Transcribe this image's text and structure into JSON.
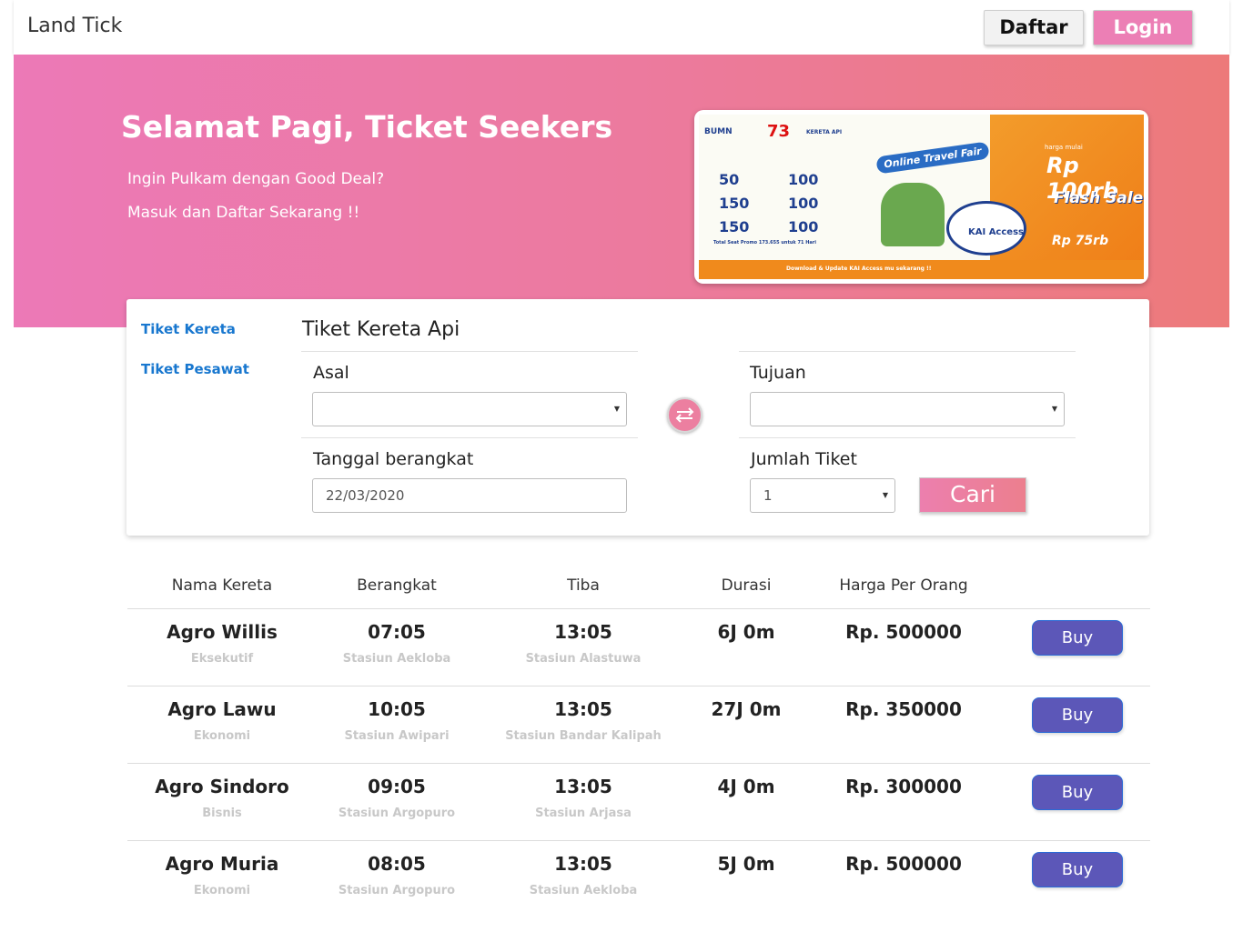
{
  "navbar": {
    "brand": "Land Tick",
    "register_label": "Daftar",
    "login_label": "Login"
  },
  "hero": {
    "title": "Selamat Pagi, Ticket Seekers",
    "line1": "Ingin Pulkam dengan Good Deal?",
    "line2": "Masuk dan Daftar Sekarang !!",
    "promo": {
      "bumn": "BUMN",
      "anniversary": "73",
      "operator": "KERETA API",
      "badge": "Online Travel Fair",
      "prices": [
        "50",
        "100",
        "150",
        "100",
        "150",
        "100"
      ],
      "total": "Total Seat Promo 173.655 untuk 71 Hari",
      "app": "KAI Access",
      "harga_mulai": "harga mulai",
      "price_main": "Rp 100rb",
      "flash": "Flash Sale",
      "price_small": "Rp 75rb",
      "footer": "Download & Update KAI Access mu sekarang !!"
    }
  },
  "search": {
    "tabs": [
      "Tiket Kereta",
      "Tiket Pesawat"
    ],
    "title": "Tiket Kereta Api",
    "origin_label": "Asal",
    "origin_value": "",
    "destination_label": "Tujuan",
    "destination_value": "",
    "date_label": "Tanggal berangkat",
    "date_value": "22/03/2020",
    "qty_label": "Jumlah Tiket",
    "qty_value": "1",
    "submit_label": "Cari"
  },
  "results": {
    "headers": [
      "Nama Kereta",
      "Berangkat",
      "Tiba",
      "Durasi",
      "Harga Per Orang"
    ],
    "buy_label": "Buy",
    "rows": [
      {
        "name": "Agro Willis",
        "class": "Eksekutif",
        "depart": "07:05",
        "depart_station": "Stasiun Aekloba",
        "arrive": "13:05",
        "arrive_station": "Stasiun Alastuwa",
        "duration": "6J 0m",
        "price": "Rp. 500000"
      },
      {
        "name": "Agro Lawu",
        "class": "Ekonomi",
        "depart": "10:05",
        "depart_station": "Stasiun Awipari",
        "arrive": "13:05",
        "arrive_station": "Stasiun Bandar Kalipah",
        "duration": "27J 0m",
        "price": "Rp. 350000"
      },
      {
        "name": "Agro Sindoro",
        "class": "Bisnis",
        "depart": "09:05",
        "depart_station": "Stasiun Argopuro",
        "arrive": "13:05",
        "arrive_station": "Stasiun Arjasa",
        "duration": "4J 0m",
        "price": "Rp. 300000"
      },
      {
        "name": "Agro Muria",
        "class": "Ekonomi",
        "depart": "08:05",
        "depart_station": "Stasiun Argopuro",
        "arrive": "13:05",
        "arrive_station": "Stasiun Aekloba",
        "duration": "5J 0m",
        "price": "Rp. 500000"
      }
    ]
  },
  "colors": {
    "hero_start": "#ec79b7",
    "hero_end": "#ed7a7a",
    "login": "#ec7fb5",
    "link": "#1877cf",
    "buy": "#5c57b8"
  },
  "icons": {
    "swap": "swap-arrows-icon",
    "caret": "caret-down-icon"
  }
}
